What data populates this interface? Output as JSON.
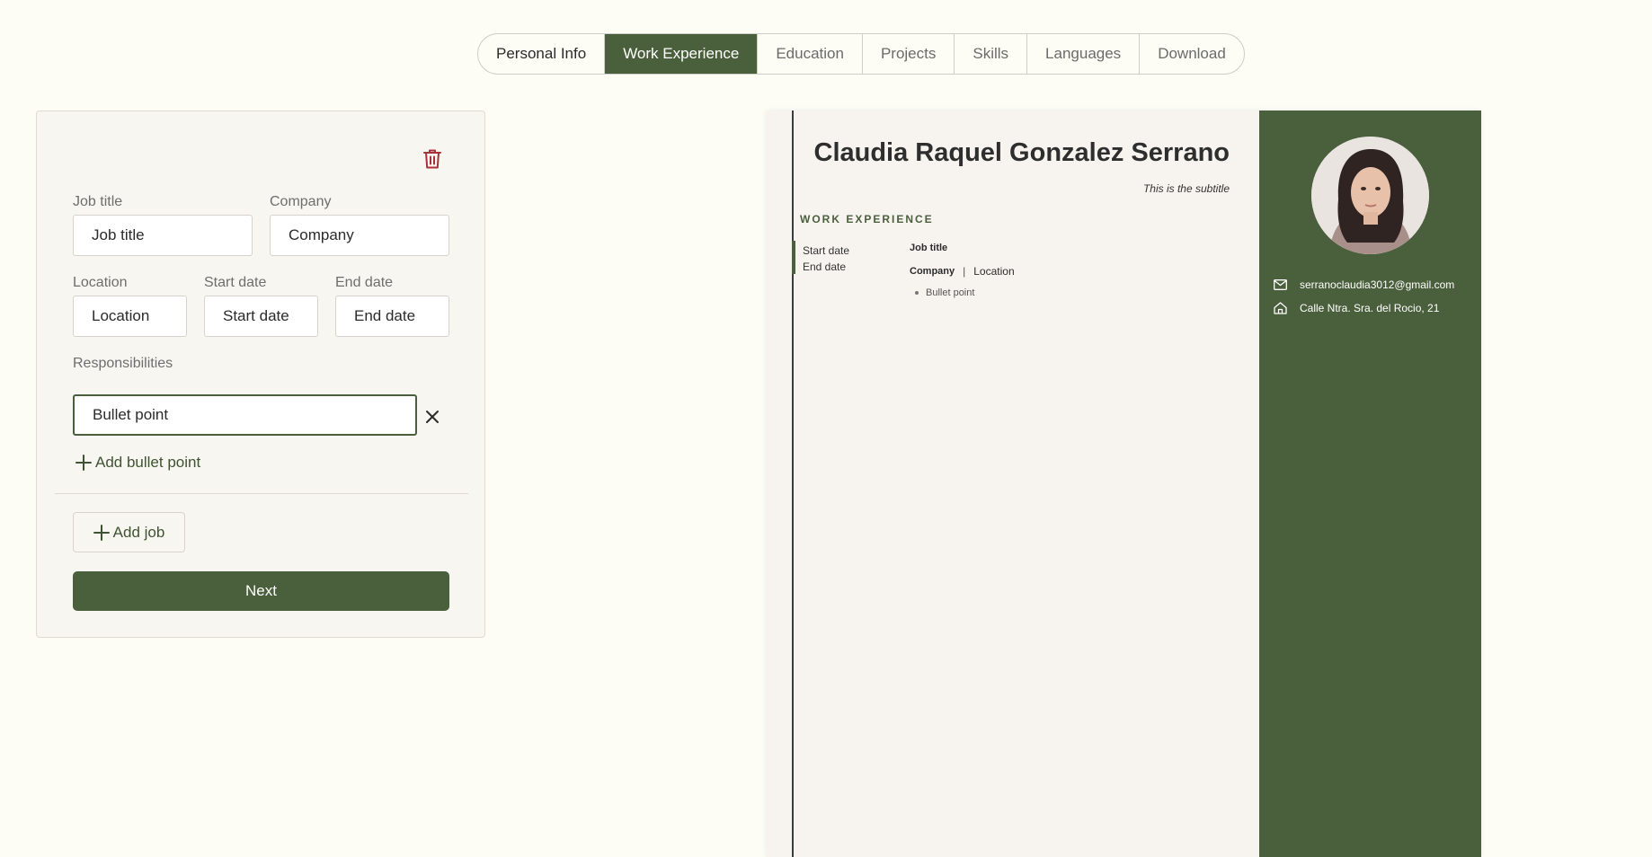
{
  "tabs": [
    {
      "label": "Personal Info"
    },
    {
      "label": "Work Experience"
    },
    {
      "label": "Education"
    },
    {
      "label": "Projects"
    },
    {
      "label": "Skills"
    },
    {
      "label": "Languages"
    },
    {
      "label": "Download"
    }
  ],
  "active_tab": "Work Experience",
  "form": {
    "job_title_label": "Job title",
    "job_title_placeholder": "Job title",
    "company_label": "Company",
    "company_placeholder": "Company",
    "location_label": "Location",
    "location_placeholder": "Location",
    "start_date_label": "Start date",
    "start_date_placeholder": "Start date",
    "end_date_label": "End date",
    "end_date_placeholder": "End date",
    "responsibilities_label": "Responsibilities",
    "bullet_placeholder": "Bullet point",
    "add_bullet_label": "Add bullet point",
    "add_job_label": "Add job",
    "next_label": "Next"
  },
  "resume": {
    "name": "Claudia Raquel Gonzalez Serrano",
    "subtitle": "This is the subtitle",
    "section_title": "WORK EXPERIENCE",
    "start_date": "Start date",
    "end_date": "End date",
    "job_title": "Job title",
    "company": "Company",
    "separator": "|",
    "location": "Location",
    "bullet": "Bullet point",
    "email": "serranoclaudia3012@gmail.com",
    "address": "Calle Ntra. Sra. del Rocio, 21"
  },
  "colors": {
    "accent": "#4a5f3c",
    "background": "#fdfdf6",
    "card": "#f8f6f1",
    "danger": "#a8313a"
  },
  "icons": [
    "trash-icon",
    "close-icon",
    "plus-icon",
    "mail-icon",
    "home-icon"
  ]
}
